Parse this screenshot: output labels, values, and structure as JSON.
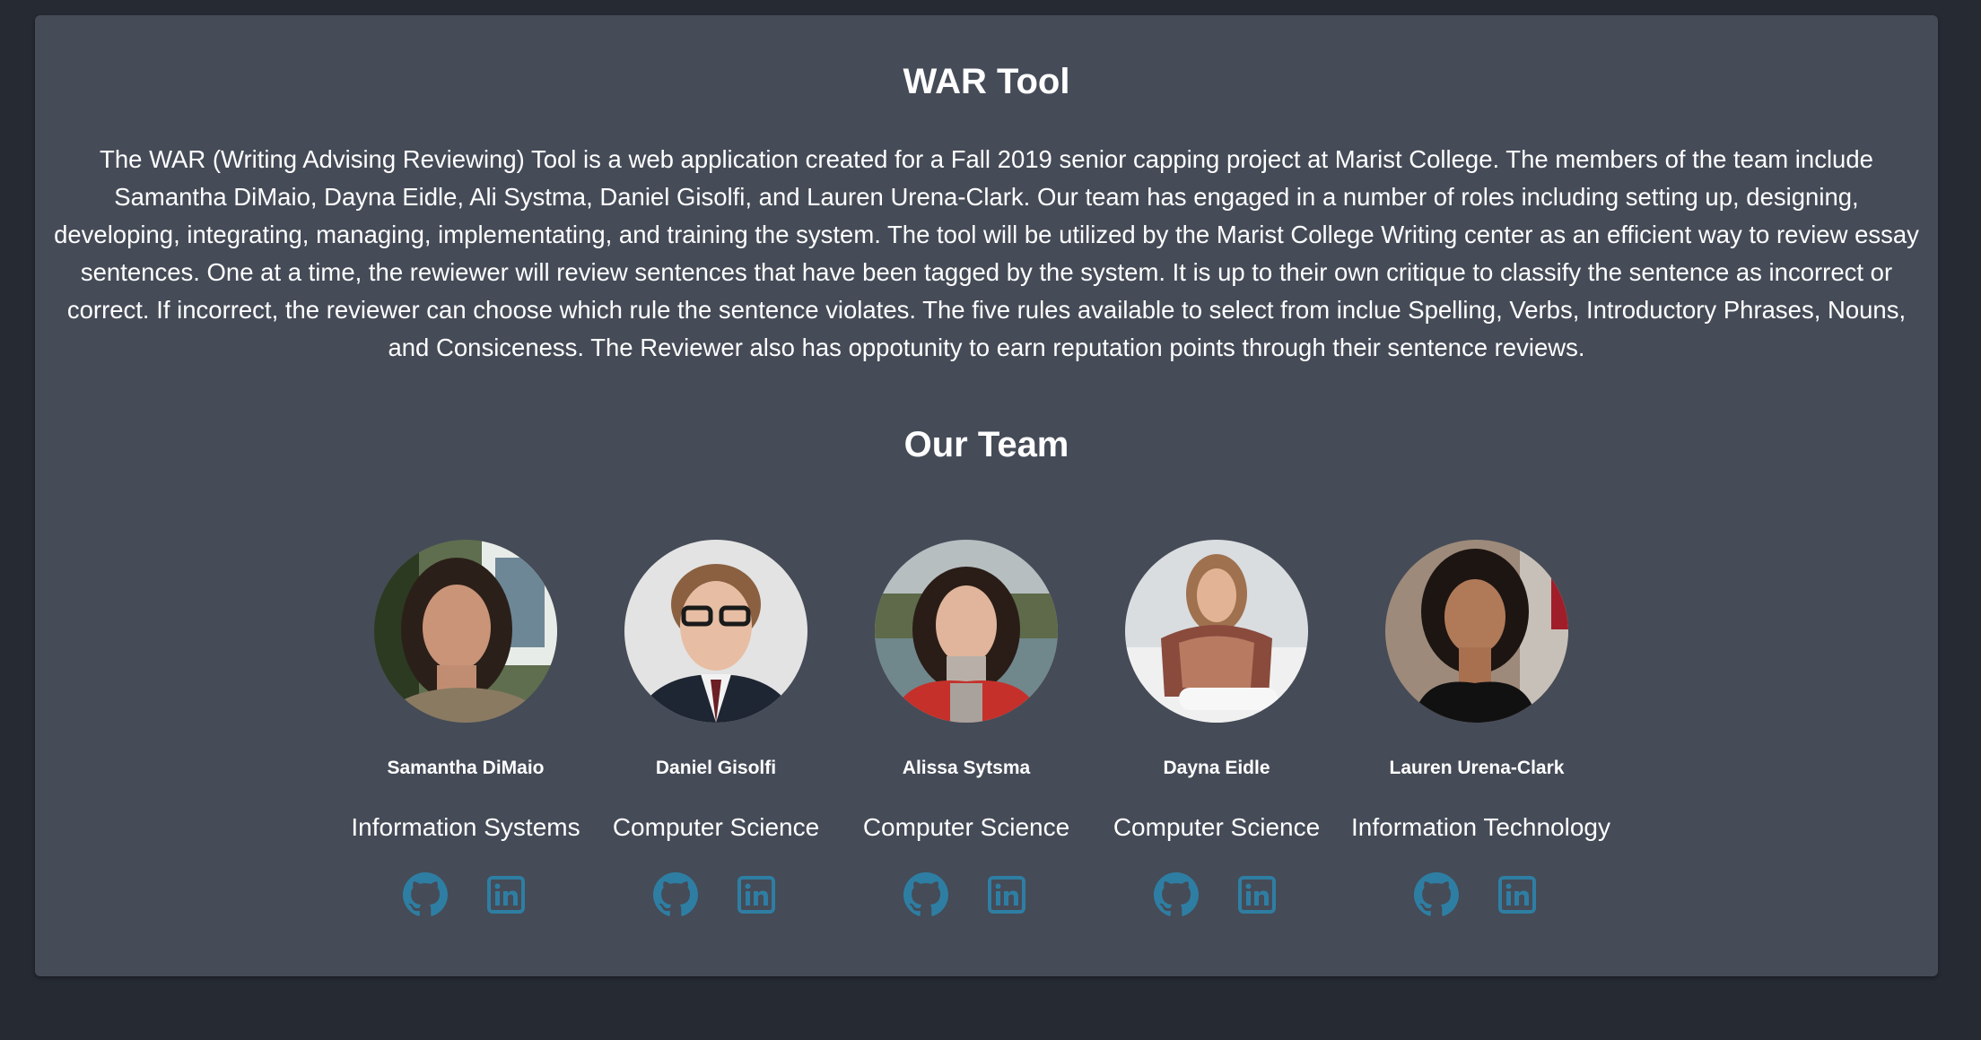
{
  "page": {
    "title": "WAR Tool",
    "about": "The WAR (Writing Advising Reviewing) Tool is a web application created for a Fall 2019 senior capping project at Marist College. The members of the team include Samantha DiMaio, Dayna Eidle, Ali Systma, Daniel Gisolfi, and Lauren Urena-Clark. Our team has engaged in a number of roles including setting up, designing, developing, integrating, managing, implementating, and training the system. The tool will be utilized by the Marist College Writing center as an efficient way to review essay sentences. One at a time, the rewiewer will review sentences that have been tagged by the system. It is up to their own critique to classify the sentence as incorrect or correct. If incorrect, the reviewer can choose which rule the sentence violates. The five rules available to select from inclue Spelling, Verbs, Introductory Phrases, Nouns, and Consiceness. The Reviewer also has oppotunity to earn reputation points through their sentence reviews.",
    "team_title": "Our Team"
  },
  "team": [
    {
      "name": "Samantha DiMaio",
      "major": "Information Systems",
      "github_icon": "github-icon",
      "linkedin_icon": "linkedin-icon"
    },
    {
      "name": "Daniel Gisolfi",
      "major": "Computer Science",
      "github_icon": "github-icon",
      "linkedin_icon": "linkedin-icon"
    },
    {
      "name": "Alissa Sytsma",
      "major": "Computer Science",
      "github_icon": "github-icon",
      "linkedin_icon": "linkedin-icon"
    },
    {
      "name": "Dayna Eidle",
      "major": "Computer Science",
      "github_icon": "github-icon",
      "linkedin_icon": "linkedin-icon"
    },
    {
      "name": "Lauren Urena-Clark",
      "major": "Information Technology",
      "github_icon": "github-icon",
      "linkedin_icon": "linkedin-icon"
    }
  ],
  "colors": {
    "page_background": "#262a33",
    "card_background": "#454b57",
    "text": "#ffffff",
    "icon_accent": "#2e7ea3"
  }
}
